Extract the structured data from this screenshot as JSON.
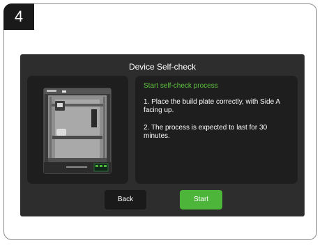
{
  "step_number": "4",
  "screen": {
    "title": "Device Self-check",
    "heading": "Start self-check process",
    "steps": [
      "1. Place the build plate correctly, with Side A facing up.",
      "2. The process is expected to last for 30 minutes."
    ],
    "buttons": {
      "back_label": "Back",
      "start_label": "Start"
    }
  },
  "colors": {
    "screen_bg": "#2d2d2d",
    "panel_bg": "#1e1e1e",
    "accent_green": "#4db53a",
    "heading_green": "#5ec43f"
  },
  "icons": {
    "device_image": "printer-illustration"
  }
}
